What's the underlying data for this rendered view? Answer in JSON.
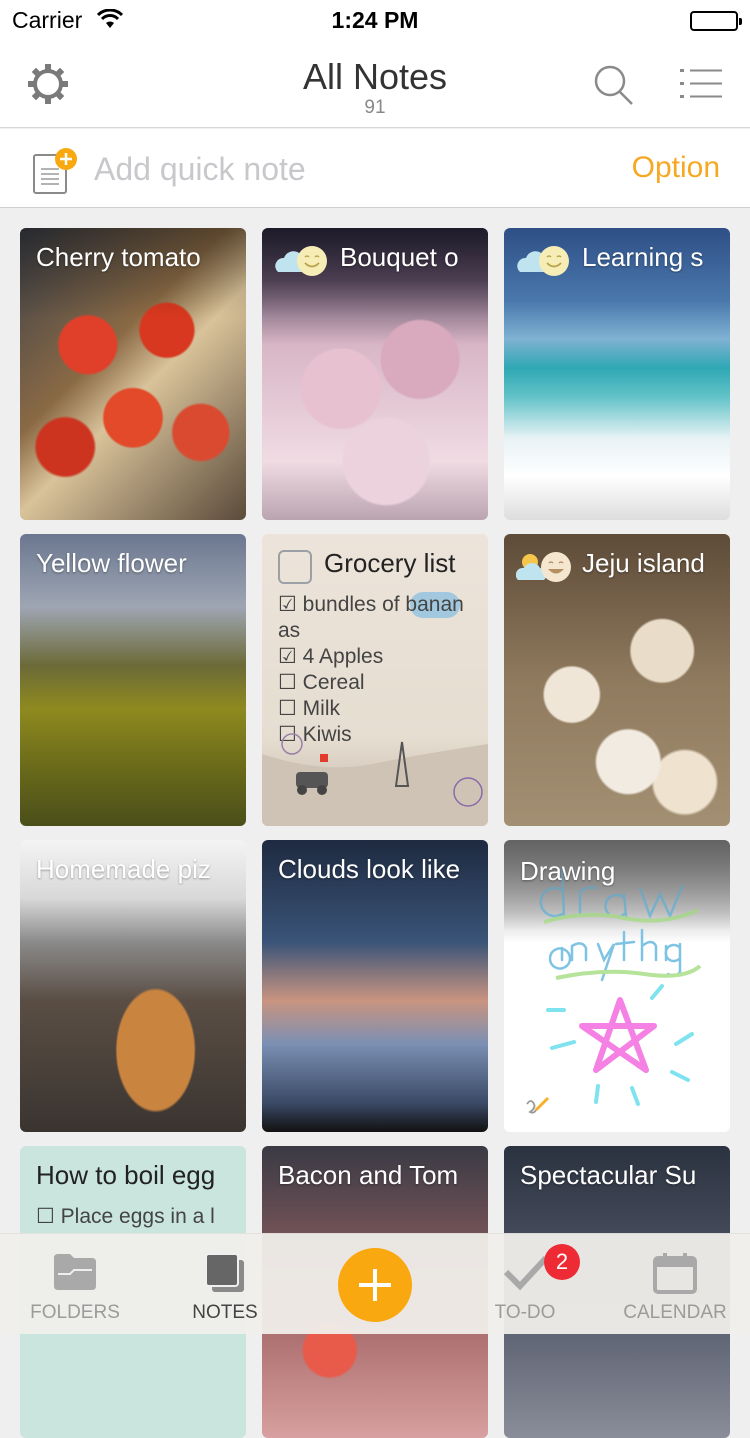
{
  "status_bar": {
    "carrier": "Carrier",
    "time": "1:24 PM"
  },
  "header": {
    "title": "All Notes",
    "count": "91"
  },
  "quick_note": {
    "placeholder": "Add quick note",
    "option_label": "Option"
  },
  "notes": [
    {
      "title": "Cherry tomato",
      "weather": null
    },
    {
      "title": "Bouquet o",
      "weather": "cloudy-smile"
    },
    {
      "title": "Learning s",
      "weather": "cloudy-smile"
    },
    {
      "title": "Yellow flower",
      "weather": null
    },
    {
      "title": "Grocery list",
      "items": [
        {
          "text": "bundles of banan",
          "checked": true
        },
        {
          "text": "as",
          "checked": null
        },
        {
          "text": "4 Apples",
          "checked": true
        },
        {
          "text": "Cereal",
          "checked": false
        },
        {
          "text": "Milk",
          "checked": false
        },
        {
          "text": "Kiwis",
          "checked": false
        }
      ]
    },
    {
      "title": "Jeju island",
      "weather": "sunny-cloud-grin"
    },
    {
      "title": "Homemade piz",
      "weather": null
    },
    {
      "title": "Clouds look like",
      "weather": null
    },
    {
      "title": "Drawing",
      "weather": null
    },
    {
      "title": "How to boil egg",
      "first_item": "Place eggs in a l",
      "first_checked": false
    },
    {
      "title": "Bacon and Tom",
      "weather": null
    },
    {
      "title": "Spectacular Su",
      "weather": null
    }
  ],
  "glyphs": {
    "checked": "☑",
    "unchecked": "☐"
  },
  "tabbar": {
    "tabs": [
      {
        "label": "FOLDERS",
        "icon": "folder-icon",
        "active": false
      },
      {
        "label": "NOTES",
        "icon": "notes-icon",
        "active": true
      },
      {
        "label": "TO-DO",
        "icon": "check-icon",
        "active": false,
        "badge": "2"
      },
      {
        "label": "CALENDAR",
        "icon": "calendar-icon",
        "active": false
      }
    ]
  },
  "colors": {
    "accent": "#f9a80f",
    "badge": "#ee2b35",
    "option": "#f7a823"
  }
}
